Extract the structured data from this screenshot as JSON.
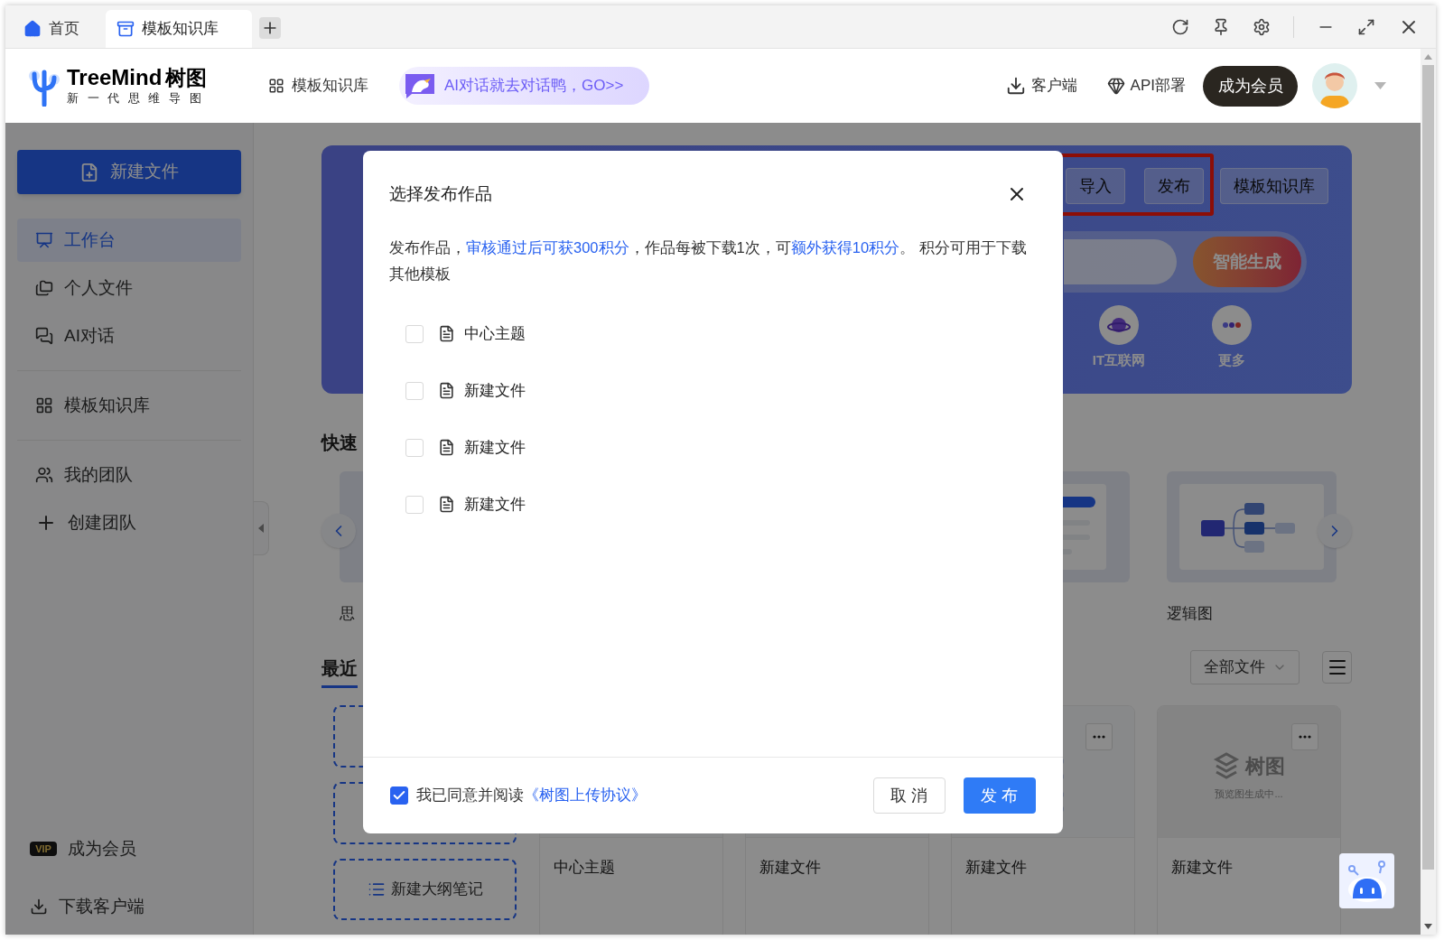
{
  "tabs": [
    {
      "label": "首页",
      "kind": "home",
      "selected": false
    },
    {
      "label": "模板知识库",
      "kind": "template",
      "selected": true
    }
  ],
  "header": {
    "logo_name": "TreeMind",
    "logo_name_cn": "树图",
    "logo_tagline": "新 一 代 思 维 导 图",
    "nav": "模板知识库",
    "ai_banner": "AI对话就去对话鸭，GO>>",
    "client": "客户端",
    "api": "API部署",
    "member_button": "成为会员"
  },
  "sidebar": {
    "new_file": "新建文件",
    "groups": [
      [
        {
          "label": "工作台",
          "kind": "monitor",
          "selected": true
        },
        {
          "label": "个人文件",
          "kind": "folder",
          "selected": false
        },
        {
          "label": "AI对话",
          "kind": "ai",
          "selected": false
        }
      ],
      [
        {
          "label": "模板知识库",
          "kind": "grid",
          "selected": false
        }
      ],
      [
        {
          "label": "我的团队",
          "kind": "team",
          "selected": false
        },
        {
          "label": "创建团队",
          "kind": "plus",
          "selected": false
        }
      ]
    ],
    "footer": [
      {
        "label": "成为会员",
        "kind": "vip",
        "badge": "VIP"
      },
      {
        "label": "下载客户端",
        "kind": "download"
      }
    ]
  },
  "banner": {
    "buttons": [
      {
        "label": "导入",
        "highlighted": true
      },
      {
        "label": "发布",
        "highlighted": true
      },
      {
        "label": "模板知识库",
        "highlighted": false
      }
    ],
    "generate_button": "智能生成",
    "shortcuts": [
      {
        "label": "IT互联网",
        "kind": "planet"
      },
      {
        "label": "更多",
        "kind": "more"
      }
    ]
  },
  "quick_create": {
    "title": "快速",
    "templates": [
      {
        "label": "思"
      },
      {
        "label": "逻辑图"
      }
    ]
  },
  "recent": {
    "tab": "最近",
    "filter": "全部文件",
    "new_outline": "新建大纲笔记",
    "files": [
      {
        "title": "中心主题",
        "kind": "blank"
      },
      {
        "title": "新建文件",
        "kind": "blank"
      },
      {
        "title": "新建文件",
        "kind": "mindmap"
      },
      {
        "title": "新建文件",
        "kind": "placeholder",
        "placeholder_logo": "树图",
        "placeholder_text": "预览图生成中..."
      }
    ]
  },
  "dialog": {
    "title": "选择发布作品",
    "description": [
      {
        "text": "发布作品，",
        "kind": "text"
      },
      {
        "text": "审核通过后可获300积分",
        "kind": "link"
      },
      {
        "text": "，作品每被下载1次，可",
        "kind": "text"
      },
      {
        "text": "额外获得10积分",
        "kind": "link"
      },
      {
        "text": "。 积分可用于下载其他模板",
        "kind": "text"
      }
    ],
    "works": [
      {
        "name": "中心主题",
        "checked": false
      },
      {
        "name": "新建文件",
        "checked": false
      },
      {
        "name": "新建文件",
        "checked": false
      },
      {
        "name": "新建文件",
        "checked": false
      }
    ],
    "agreement": {
      "checked": true,
      "text": "我已同意并阅读",
      "link": "《树图上传协议》"
    },
    "cancel": "取 消",
    "submit": "发 布"
  }
}
